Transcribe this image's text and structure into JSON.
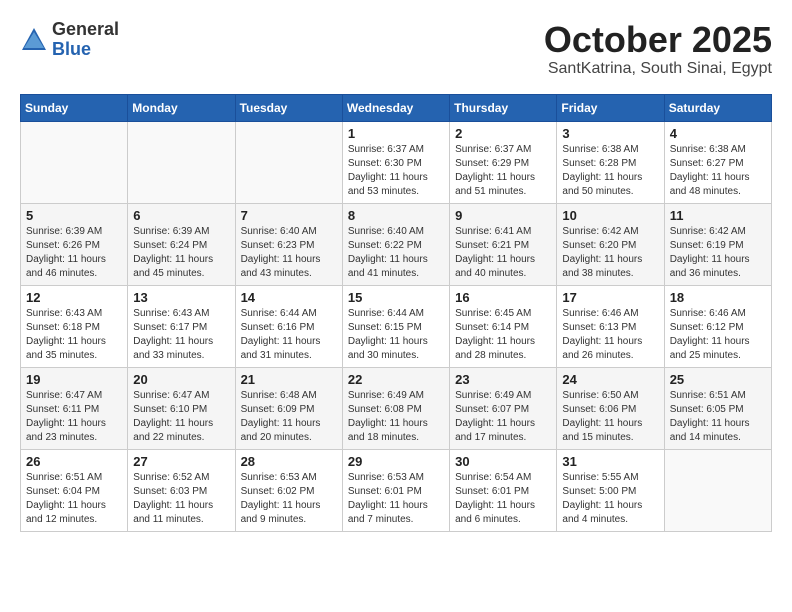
{
  "logo": {
    "general": "General",
    "blue": "Blue"
  },
  "title": "October 2025",
  "subtitle": "SantKatrina, South Sinai, Egypt",
  "headers": [
    "Sunday",
    "Monday",
    "Tuesday",
    "Wednesday",
    "Thursday",
    "Friday",
    "Saturday"
  ],
  "weeks": [
    [
      {
        "day": "",
        "info": ""
      },
      {
        "day": "",
        "info": ""
      },
      {
        "day": "",
        "info": ""
      },
      {
        "day": "1",
        "info": "Sunrise: 6:37 AM\nSunset: 6:30 PM\nDaylight: 11 hours and 53 minutes."
      },
      {
        "day": "2",
        "info": "Sunrise: 6:37 AM\nSunset: 6:29 PM\nDaylight: 11 hours and 51 minutes."
      },
      {
        "day": "3",
        "info": "Sunrise: 6:38 AM\nSunset: 6:28 PM\nDaylight: 11 hours and 50 minutes."
      },
      {
        "day": "4",
        "info": "Sunrise: 6:38 AM\nSunset: 6:27 PM\nDaylight: 11 hours and 48 minutes."
      }
    ],
    [
      {
        "day": "5",
        "info": "Sunrise: 6:39 AM\nSunset: 6:26 PM\nDaylight: 11 hours and 46 minutes."
      },
      {
        "day": "6",
        "info": "Sunrise: 6:39 AM\nSunset: 6:24 PM\nDaylight: 11 hours and 45 minutes."
      },
      {
        "day": "7",
        "info": "Sunrise: 6:40 AM\nSunset: 6:23 PM\nDaylight: 11 hours and 43 minutes."
      },
      {
        "day": "8",
        "info": "Sunrise: 6:40 AM\nSunset: 6:22 PM\nDaylight: 11 hours and 41 minutes."
      },
      {
        "day": "9",
        "info": "Sunrise: 6:41 AM\nSunset: 6:21 PM\nDaylight: 11 hours and 40 minutes."
      },
      {
        "day": "10",
        "info": "Sunrise: 6:42 AM\nSunset: 6:20 PM\nDaylight: 11 hours and 38 minutes."
      },
      {
        "day": "11",
        "info": "Sunrise: 6:42 AM\nSunset: 6:19 PM\nDaylight: 11 hours and 36 minutes."
      }
    ],
    [
      {
        "day": "12",
        "info": "Sunrise: 6:43 AM\nSunset: 6:18 PM\nDaylight: 11 hours and 35 minutes."
      },
      {
        "day": "13",
        "info": "Sunrise: 6:43 AM\nSunset: 6:17 PM\nDaylight: 11 hours and 33 minutes."
      },
      {
        "day": "14",
        "info": "Sunrise: 6:44 AM\nSunset: 6:16 PM\nDaylight: 11 hours and 31 minutes."
      },
      {
        "day": "15",
        "info": "Sunrise: 6:44 AM\nSunset: 6:15 PM\nDaylight: 11 hours and 30 minutes."
      },
      {
        "day": "16",
        "info": "Sunrise: 6:45 AM\nSunset: 6:14 PM\nDaylight: 11 hours and 28 minutes."
      },
      {
        "day": "17",
        "info": "Sunrise: 6:46 AM\nSunset: 6:13 PM\nDaylight: 11 hours and 26 minutes."
      },
      {
        "day": "18",
        "info": "Sunrise: 6:46 AM\nSunset: 6:12 PM\nDaylight: 11 hours and 25 minutes."
      }
    ],
    [
      {
        "day": "19",
        "info": "Sunrise: 6:47 AM\nSunset: 6:11 PM\nDaylight: 11 hours and 23 minutes."
      },
      {
        "day": "20",
        "info": "Sunrise: 6:47 AM\nSunset: 6:10 PM\nDaylight: 11 hours and 22 minutes."
      },
      {
        "day": "21",
        "info": "Sunrise: 6:48 AM\nSunset: 6:09 PM\nDaylight: 11 hours and 20 minutes."
      },
      {
        "day": "22",
        "info": "Sunrise: 6:49 AM\nSunset: 6:08 PM\nDaylight: 11 hours and 18 minutes."
      },
      {
        "day": "23",
        "info": "Sunrise: 6:49 AM\nSunset: 6:07 PM\nDaylight: 11 hours and 17 minutes."
      },
      {
        "day": "24",
        "info": "Sunrise: 6:50 AM\nSunset: 6:06 PM\nDaylight: 11 hours and 15 minutes."
      },
      {
        "day": "25",
        "info": "Sunrise: 6:51 AM\nSunset: 6:05 PM\nDaylight: 11 hours and 14 minutes."
      }
    ],
    [
      {
        "day": "26",
        "info": "Sunrise: 6:51 AM\nSunset: 6:04 PM\nDaylight: 11 hours and 12 minutes."
      },
      {
        "day": "27",
        "info": "Sunrise: 6:52 AM\nSunset: 6:03 PM\nDaylight: 11 hours and 11 minutes."
      },
      {
        "day": "28",
        "info": "Sunrise: 6:53 AM\nSunset: 6:02 PM\nDaylight: 11 hours and 9 minutes."
      },
      {
        "day": "29",
        "info": "Sunrise: 6:53 AM\nSunset: 6:01 PM\nDaylight: 11 hours and 7 minutes."
      },
      {
        "day": "30",
        "info": "Sunrise: 6:54 AM\nSunset: 6:01 PM\nDaylight: 11 hours and 6 minutes."
      },
      {
        "day": "31",
        "info": "Sunrise: 5:55 AM\nSunset: 5:00 PM\nDaylight: 11 hours and 4 minutes."
      },
      {
        "day": "",
        "info": ""
      }
    ]
  ]
}
